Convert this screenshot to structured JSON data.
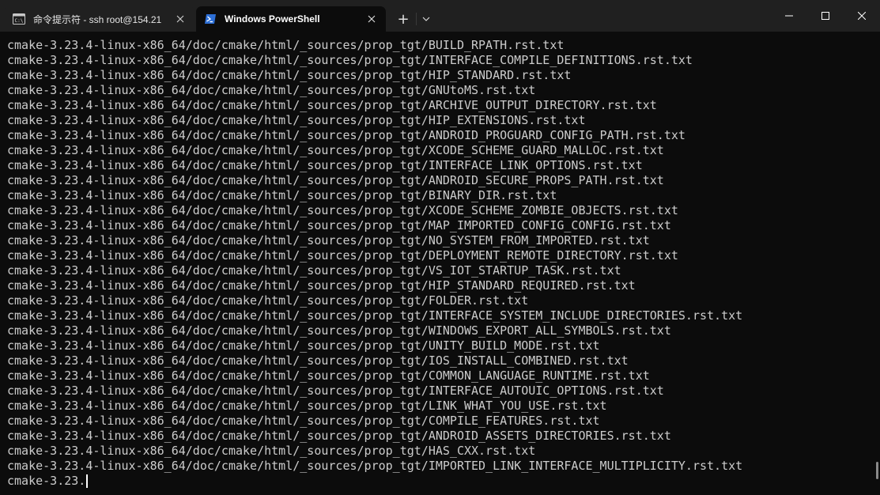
{
  "tabs": [
    {
      "title": "命令提示符 - ssh  root@154.21",
      "icon": "cmd-icon",
      "active": false
    },
    {
      "title": "Windows PowerShell",
      "icon": "powershell-icon",
      "active": true
    }
  ],
  "tabbar": {
    "new_tab_label": "+",
    "dropdown_icon": "chevron-down-icon"
  },
  "window_controls": {
    "minimize_icon": "minimize-icon",
    "maximize_icon": "maximize-icon",
    "close_icon": "close-icon"
  },
  "terminal": {
    "lines": [
      "cmake-3.23.4-linux-x86_64/doc/cmake/html/_sources/prop_tgt/BUILD_RPATH.rst.txt",
      "cmake-3.23.4-linux-x86_64/doc/cmake/html/_sources/prop_tgt/INTERFACE_COMPILE_DEFINITIONS.rst.txt",
      "cmake-3.23.4-linux-x86_64/doc/cmake/html/_sources/prop_tgt/HIP_STANDARD.rst.txt",
      "cmake-3.23.4-linux-x86_64/doc/cmake/html/_sources/prop_tgt/GNUtoMS.rst.txt",
      "cmake-3.23.4-linux-x86_64/doc/cmake/html/_sources/prop_tgt/ARCHIVE_OUTPUT_DIRECTORY.rst.txt",
      "cmake-3.23.4-linux-x86_64/doc/cmake/html/_sources/prop_tgt/HIP_EXTENSIONS.rst.txt",
      "cmake-3.23.4-linux-x86_64/doc/cmake/html/_sources/prop_tgt/ANDROID_PROGUARD_CONFIG_PATH.rst.txt",
      "cmake-3.23.4-linux-x86_64/doc/cmake/html/_sources/prop_tgt/XCODE_SCHEME_GUARD_MALLOC.rst.txt",
      "cmake-3.23.4-linux-x86_64/doc/cmake/html/_sources/prop_tgt/INTERFACE_LINK_OPTIONS.rst.txt",
      "cmake-3.23.4-linux-x86_64/doc/cmake/html/_sources/prop_tgt/ANDROID_SECURE_PROPS_PATH.rst.txt",
      "cmake-3.23.4-linux-x86_64/doc/cmake/html/_sources/prop_tgt/BINARY_DIR.rst.txt",
      "cmake-3.23.4-linux-x86_64/doc/cmake/html/_sources/prop_tgt/XCODE_SCHEME_ZOMBIE_OBJECTS.rst.txt",
      "cmake-3.23.4-linux-x86_64/doc/cmake/html/_sources/prop_tgt/MAP_IMPORTED_CONFIG_CONFIG.rst.txt",
      "cmake-3.23.4-linux-x86_64/doc/cmake/html/_sources/prop_tgt/NO_SYSTEM_FROM_IMPORTED.rst.txt",
      "cmake-3.23.4-linux-x86_64/doc/cmake/html/_sources/prop_tgt/DEPLOYMENT_REMOTE_DIRECTORY.rst.txt",
      "cmake-3.23.4-linux-x86_64/doc/cmake/html/_sources/prop_tgt/VS_IOT_STARTUP_TASK.rst.txt",
      "cmake-3.23.4-linux-x86_64/doc/cmake/html/_sources/prop_tgt/HIP_STANDARD_REQUIRED.rst.txt",
      "cmake-3.23.4-linux-x86_64/doc/cmake/html/_sources/prop_tgt/FOLDER.rst.txt",
      "cmake-3.23.4-linux-x86_64/doc/cmake/html/_sources/prop_tgt/INTERFACE_SYSTEM_INCLUDE_DIRECTORIES.rst.txt",
      "cmake-3.23.4-linux-x86_64/doc/cmake/html/_sources/prop_tgt/WINDOWS_EXPORT_ALL_SYMBOLS.rst.txt",
      "cmake-3.23.4-linux-x86_64/doc/cmake/html/_sources/prop_tgt/UNITY_BUILD_MODE.rst.txt",
      "cmake-3.23.4-linux-x86_64/doc/cmake/html/_sources/prop_tgt/IOS_INSTALL_COMBINED.rst.txt",
      "cmake-3.23.4-linux-x86_64/doc/cmake/html/_sources/prop_tgt/COMMON_LANGUAGE_RUNTIME.rst.txt",
      "cmake-3.23.4-linux-x86_64/doc/cmake/html/_sources/prop_tgt/INTERFACE_AUTOUIC_OPTIONS.rst.txt",
      "cmake-3.23.4-linux-x86_64/doc/cmake/html/_sources/prop_tgt/LINK_WHAT_YOU_USE.rst.txt",
      "cmake-3.23.4-linux-x86_64/doc/cmake/html/_sources/prop_tgt/COMPILE_FEATURES.rst.txt",
      "cmake-3.23.4-linux-x86_64/doc/cmake/html/_sources/prop_tgt/ANDROID_ASSETS_DIRECTORIES.rst.txt",
      "cmake-3.23.4-linux-x86_64/doc/cmake/html/_sources/prop_tgt/HAS_CXX.rst.txt",
      "cmake-3.23.4-linux-x86_64/doc/cmake/html/_sources/prop_tgt/IMPORTED_LINK_INTERFACE_MULTIPLICITY.rst.txt"
    ],
    "current_line": "cmake-3.23.",
    "background_color": "#0c0c0c",
    "text_color": "#cccccc"
  }
}
